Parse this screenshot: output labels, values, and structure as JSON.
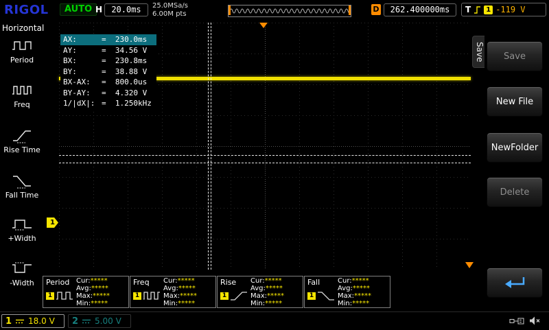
{
  "colors": {
    "ch1": "#f5e400",
    "ch2": "#17807f",
    "trigger_orange": "#ff8c00",
    "cursor_highlight": "#0c6e7d",
    "status_green": "#00d000",
    "logo_blue": "#2535d6",
    "menu_accent": "#49aaff"
  },
  "icons": {
    "trigger-slope": "rising-edge",
    "ch1-coupling": "dc",
    "ch2-coupling": "dc",
    "return": "back-arrow",
    "usb": "usb-plug",
    "beeper": "speaker-muted"
  },
  "top_bar": {
    "logo": "RIGOL",
    "status": "AUTO",
    "horizontal": {
      "label": "H",
      "timebase": "20.0ms"
    },
    "acquisition": {
      "sample_rate": "25.0MSa/s",
      "memory_depth": "6.00M pts"
    },
    "delay": {
      "label": "D",
      "value": "262.400000ms"
    },
    "trigger": {
      "label": "T",
      "source": "1",
      "level": "-119 V"
    }
  },
  "sidebar": {
    "title": "Horizontal",
    "items": [
      {
        "label": "Period"
      },
      {
        "label": "Freq"
      },
      {
        "label": "Rise Time"
      },
      {
        "label": "Fall Time"
      },
      {
        "label": "+Width"
      },
      {
        "label": "-Width"
      }
    ]
  },
  "cursor_box": {
    "rows": [
      {
        "label": "AX:",
        "value": "=  230.0ms"
      },
      {
        "label": "AY:",
        "value": "=  34.56 V"
      },
      {
        "label": "BX:",
        "value": "=  230.8ms"
      },
      {
        "label": "BY:",
        "value": "=  38.88 V"
      },
      {
        "label": "BX-AX:",
        "value": "=  800.0us"
      },
      {
        "label": "BY-AY:",
        "value": "=  4.320 V"
      },
      {
        "label": "1/|dX|:",
        "value": "=  1.250kHz"
      }
    ]
  },
  "measurements": [
    {
      "name": "Period",
      "channel": "1",
      "stats": [
        {
          "label": "Cur:",
          "value": "*****"
        },
        {
          "label": "Avg:",
          "value": "*****"
        },
        {
          "label": "Max:",
          "value": "*****"
        },
        {
          "label": "Min:",
          "value": "*****"
        }
      ]
    },
    {
      "name": "Freq",
      "channel": "1",
      "stats": [
        {
          "label": "Cur:",
          "value": "*****"
        },
        {
          "label": "Avg:",
          "value": "*****"
        },
        {
          "label": "Max:",
          "value": "*****"
        },
        {
          "label": "Min:",
          "value": "*****"
        }
      ]
    },
    {
      "name": "Rise",
      "channel": "1",
      "stats": [
        {
          "label": "Cur:",
          "value": "*****"
        },
        {
          "label": "Avg:",
          "value": "*****"
        },
        {
          "label": "Max:",
          "value": "*****"
        },
        {
          "label": "Min:",
          "value": "*****"
        }
      ]
    },
    {
      "name": "Fall",
      "channel": "1",
      "stats": [
        {
          "label": "Cur:",
          "value": "*****"
        },
        {
          "label": "Avg:",
          "value": "*****"
        },
        {
          "label": "Max:",
          "value": "*****"
        },
        {
          "label": "Min:",
          "value": "*****"
        }
      ]
    }
  ],
  "menu": {
    "tab": "Save",
    "buttons": [
      {
        "label": "Save",
        "enabled": false
      },
      {
        "label": "New File",
        "enabled": true
      },
      {
        "label": "NewFolder",
        "enabled": true
      },
      {
        "label": "Delete",
        "enabled": false
      }
    ]
  },
  "channels": [
    {
      "number": "1",
      "scale": "18.0 V"
    },
    {
      "number": "2",
      "scale": "5.00 V"
    }
  ]
}
